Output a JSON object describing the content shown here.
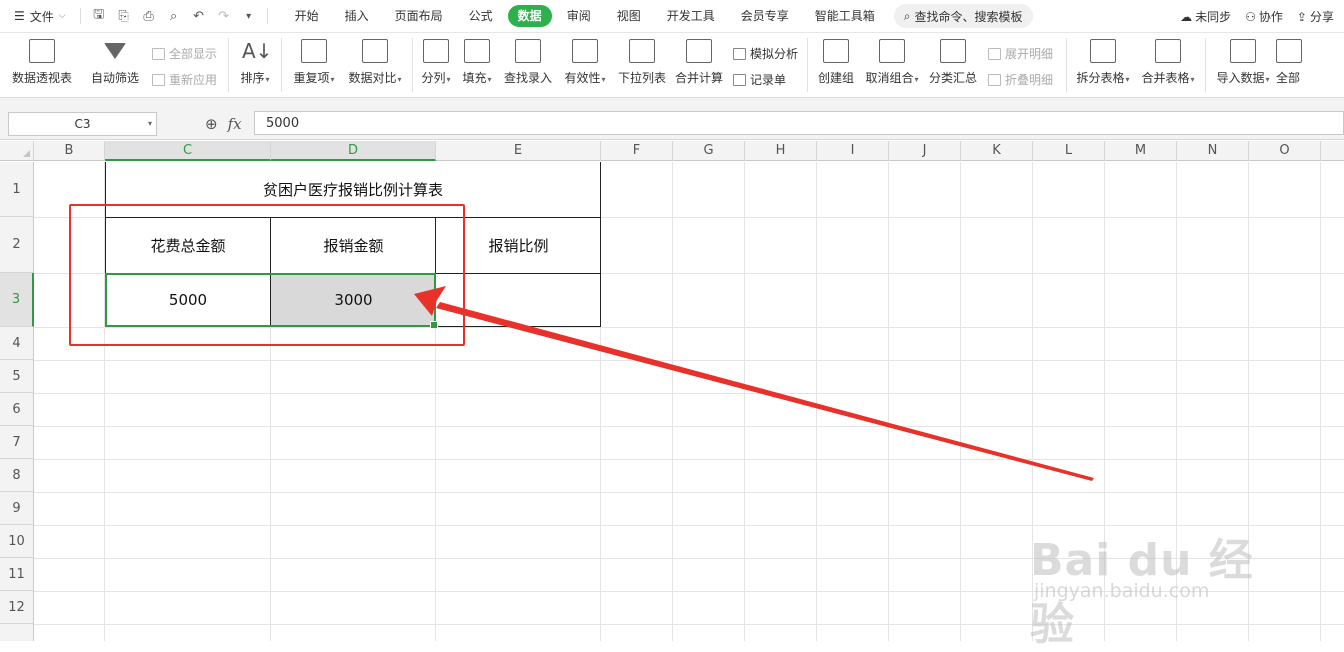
{
  "titlebar": {
    "file_menu": "文件",
    "tabs": [
      "开始",
      "插入",
      "页面布局",
      "公式",
      "数据",
      "审阅",
      "视图",
      "开发工具",
      "会员专享",
      "智能工具箱"
    ],
    "active_tab": "数据",
    "search_placeholder": "查找命令、搜索模板",
    "unsynced": "未同步",
    "collaborate": "协作",
    "share": "分享"
  },
  "ribbon": {
    "pivot_table": "数据透视表",
    "auto_filter": "自动筛选",
    "show_all": "全部显示",
    "reapply": "重新应用",
    "sort": "排序",
    "duplicates": "重复项",
    "data_compare": "数据对比",
    "split_column": "分列",
    "fill": "填充",
    "lookup_entry": "查找录入",
    "validity": "有效性",
    "dropdown_list": "下拉列表",
    "consolidate": "合并计算",
    "what_if": "模拟分析",
    "record_form": "记录单",
    "create_group": "创建组",
    "ungroup": "取消组合",
    "subtotal": "分类汇总",
    "expand_detail": "展开明细",
    "collapse_detail": "折叠明细",
    "split_table": "拆分表格",
    "merge_table": "合并表格",
    "import_data": "导入数据",
    "all": "全部"
  },
  "formula_bar": {
    "cell_ref": "C3",
    "fx_label": "fx",
    "value": "5000"
  },
  "sheet": {
    "columns": [
      "B",
      "C",
      "D",
      "E",
      "F",
      "G",
      "H",
      "I",
      "J",
      "K",
      "L",
      "M",
      "N",
      "O"
    ],
    "rows": [
      "1",
      "2",
      "3",
      "4",
      "5",
      "6",
      "7",
      "8",
      "9",
      "10",
      "11",
      "12"
    ],
    "title": "贫困户医疗报销比例计算表",
    "headers": [
      "花费总金额",
      "报销金额",
      "报销比例"
    ],
    "values": [
      "5000",
      "3000",
      ""
    ]
  },
  "colors": {
    "accent_green": "#2bb24c",
    "annotation_red": "#e8312a"
  },
  "watermark": {
    "brand": "Bai du 经验",
    "url": "jingyan.baidu.com"
  }
}
